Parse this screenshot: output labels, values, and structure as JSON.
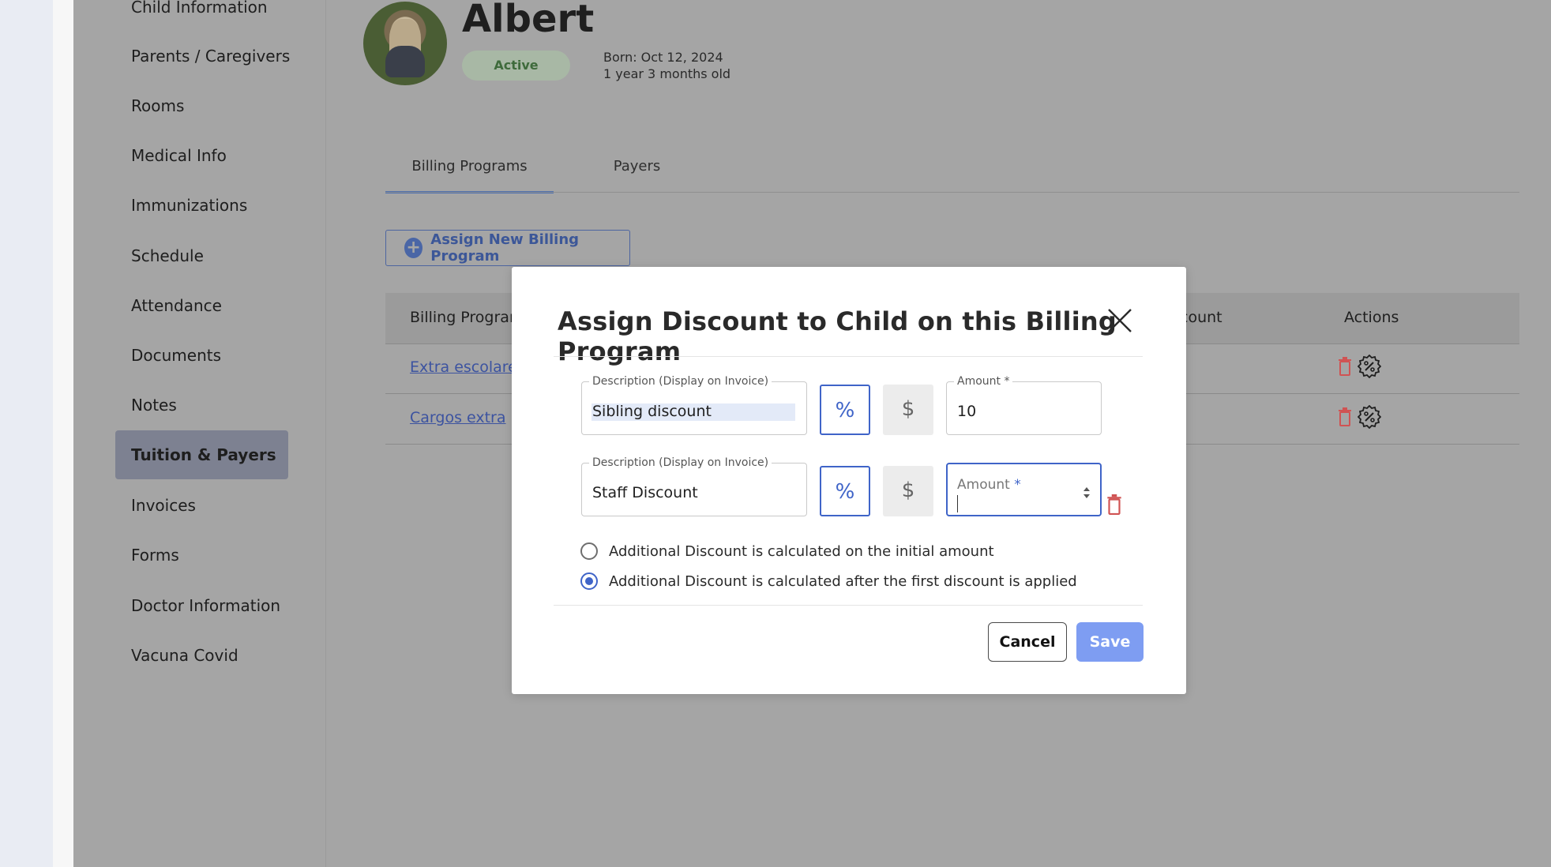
{
  "sidebar": {
    "items": [
      {
        "label": "Child Information"
      },
      {
        "label": "Parents / Caregivers"
      },
      {
        "label": "Rooms"
      },
      {
        "label": "Medical Info"
      },
      {
        "label": "Immunizations"
      },
      {
        "label": "Schedule"
      },
      {
        "label": "Attendance"
      },
      {
        "label": "Documents"
      },
      {
        "label": "Notes"
      },
      {
        "label": "Tuition & Payers",
        "active": true
      },
      {
        "label": "Invoices"
      },
      {
        "label": "Forms"
      },
      {
        "label": "Doctor Information"
      },
      {
        "label": "Vacuna Covid"
      }
    ]
  },
  "child": {
    "name": "Albert",
    "status": "Active",
    "born": "Born: Oct 12, 2024",
    "age": "1 year 3 months old"
  },
  "tabs": [
    {
      "label": "Billing Programs",
      "active": true
    },
    {
      "label": "Payers",
      "active": false
    }
  ],
  "assign_button": "Assign New Billing Program",
  "table": {
    "headers": [
      "Billing Program",
      "count",
      "Actions"
    ],
    "rows": [
      {
        "program": "Extra escolares"
      },
      {
        "program": "Cargos extra"
      }
    ]
  },
  "modal": {
    "title": "Assign Discount to Child on this Billing Program",
    "discounts": [
      {
        "description_label": "Description (Display on Invoice)",
        "description": "Sibling discount",
        "percent_symbol": "%",
        "dollar_symbol": "$",
        "amount_label": "Amount *",
        "amount": "10"
      },
      {
        "description_label": "Description (Display on Invoice)",
        "description": "Staff Discount",
        "percent_symbol": "%",
        "dollar_symbol": "$",
        "amount_label": "Amount",
        "amount_required": "*",
        "amount": ""
      }
    ],
    "calc_options": [
      {
        "label": "Additional Discount is calculated on the initial amount",
        "selected": false
      },
      {
        "label": "Additional Discount is calculated after the first discount is applied",
        "selected": true
      }
    ],
    "cancel_label": "Cancel",
    "save_label": "Save"
  },
  "colors": {
    "accent": "#3f64c8",
    "save_button": "#7e9df2",
    "delete_icon": "#d05353",
    "overlay": "#a5a5a5"
  }
}
